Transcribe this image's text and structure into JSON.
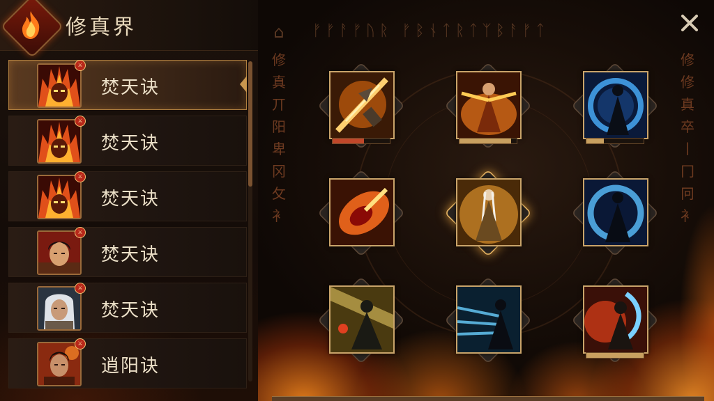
{
  "header": {
    "title": "修真界",
    "emblem_icon": "flame-emblem-icon"
  },
  "list": {
    "items": [
      {
        "label": "焚天诀",
        "avatar": "fire-demon",
        "selected": true
      },
      {
        "label": "焚天诀",
        "avatar": "fire-demon",
        "selected": false
      },
      {
        "label": "焚天诀",
        "avatar": "fire-demon",
        "selected": false
      },
      {
        "label": "焚天诀",
        "avatar": "warrior-man",
        "selected": false
      },
      {
        "label": "焚天诀",
        "avatar": "white-haired-elder",
        "selected": false
      },
      {
        "label": "逍阳诀",
        "avatar": "young-cultivator",
        "selected": false
      }
    ],
    "badge_glyph": "⚔"
  },
  "decor": {
    "rune_top": "ᚠᚠᚨᚠᚢᚱ  ᚠᛒᚾᛏᚱᛏᛉᛒᚨᚠᛏ",
    "side_left": "修 真 丌 阳 卑  冈 攵 衤",
    "side_right": "修 修 真 卒 丨  冂 冋 衤",
    "side_glyph": "⌂"
  },
  "skills": [
    {
      "name": "blade-strike",
      "progress": 0.55,
      "progress_color": "#c0472a",
      "highlight": false
    },
    {
      "name": "flame-monk",
      "progress": 0.9,
      "progress_color": "#c8a060",
      "highlight": false
    },
    {
      "name": "frost-shadow",
      "progress": 0.3,
      "progress_color": "#c8a060",
      "highlight": false
    },
    {
      "name": "fire-fang",
      "progress": null,
      "highlight": false
    },
    {
      "name": "golden-sage",
      "progress": null,
      "highlight": true
    },
    {
      "name": "blue-aura",
      "progress": null,
      "highlight": false
    },
    {
      "name": "golden-warrior",
      "progress": null,
      "highlight": false
    },
    {
      "name": "wind-cloak",
      "progress": null,
      "highlight": false
    },
    {
      "name": "storm-beast",
      "progress": 1.0,
      "progress_color": "#c8a060",
      "highlight": false
    }
  ],
  "colors": {
    "accent": "#c8964e",
    "fire": "#ff7a1a",
    "frost": "#3a8fe0"
  }
}
